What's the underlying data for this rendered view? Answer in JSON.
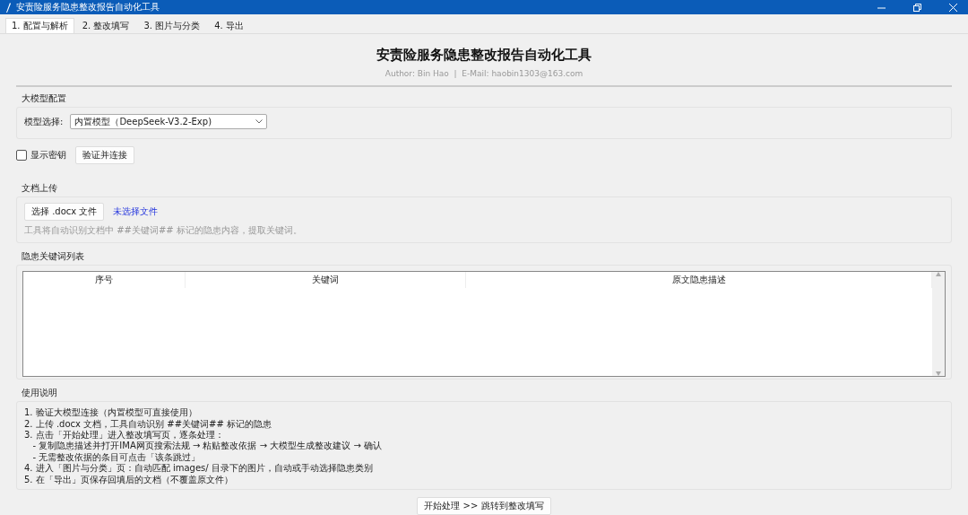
{
  "window": {
    "title": "安责险服务隐患整改报告自动化工具"
  },
  "tabs": [
    {
      "label": "1. 配置与解析",
      "selected": true
    },
    {
      "label": "2. 整改填写",
      "selected": false
    },
    {
      "label": "3. 图片与分类",
      "selected": false
    },
    {
      "label": "4. 导出",
      "selected": false
    }
  ],
  "header": {
    "title": "安责险服务隐患整改报告自动化工具",
    "author": "Author: Bin Hao  |  E-Mail: haobin1303@163.com"
  },
  "model_config": {
    "legend": "大模型配置",
    "label": "模型选择:",
    "value": "内置模型（DeepSeek-V3.2-Exp)"
  },
  "show_key": {
    "label": "显示密钥",
    "checked": false
  },
  "verify_button": "验证并连接",
  "upload": {
    "legend": "文档上传",
    "button": "选择 .docx 文件",
    "status": "未选择文件",
    "hint": "工具将自动识别文档中 ##关键词## 标记的隐患内容，提取关键词。"
  },
  "keyword_table": {
    "legend": "隐患关键词列表",
    "columns": [
      "序号",
      "关键词",
      "原文隐患描述"
    ]
  },
  "instructions": {
    "legend": "使用说明",
    "lines": [
      "1. 验证大模型连接（内置模型可直接使用）",
      "2. 上传 .docx 文档，工具自动识别 ##关键词## 标记的隐患",
      "3. 点击「开始处理」进入整改填写页，逐条处理：",
      "   - 复制隐患描述并打开IMA网页搜索法规 → 粘贴整改依据 → 大模型生成整改建议 → 确认",
      "   - 无需整改依据的条目可点击「该条跳过」",
      "4. 进入「图片与分类」页：自动匹配 images/ 目录下的图片，自动或手动选择隐患类别",
      "5. 在「导出」页保存回填后的文档（不覆盖原文件）"
    ]
  },
  "start_button": "开始处理 >> 跳转到整改填写"
}
